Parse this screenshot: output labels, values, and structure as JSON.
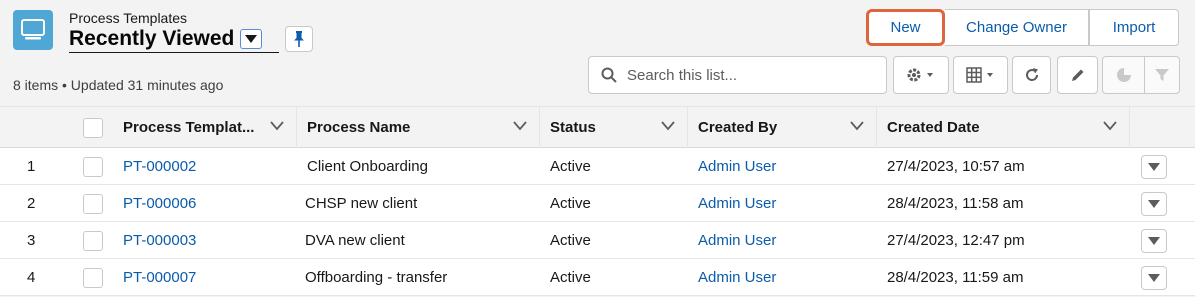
{
  "header": {
    "object_icon": "desktop-icon",
    "object_name": "Process Templates",
    "list_view": "Recently Viewed",
    "list_info": "8 items • Updated 31 minutes ago"
  },
  "actions": {
    "new": "New",
    "change_owner": "Change Owner",
    "import": "Import"
  },
  "search": {
    "placeholder": "Search this list..."
  },
  "toolbar": [
    "settings-icon",
    "table-display-icon",
    "refresh-icon",
    "edit-icon",
    "chart-icon",
    "filter-icon"
  ],
  "table": {
    "columns": [
      "Process Templat...",
      "Process Name",
      "Status",
      "Created By",
      "Created Date"
    ],
    "rows": [
      {
        "num": "1",
        "id": "PT-000002",
        "name": "Client Onboarding",
        "status": "Active",
        "created_by": "Admin User",
        "created_date": "27/4/2023, 10:57 am"
      },
      {
        "num": "2",
        "id": "PT-000006",
        "name": "CHSP new client",
        "status": "Active",
        "created_by": "Admin User",
        "created_date": "28/4/2023, 11:58 am"
      },
      {
        "num": "3",
        "id": "PT-000003",
        "name": "DVA new client",
        "status": "Active",
        "created_by": "Admin User",
        "created_date": "27/4/2023, 12:47 pm"
      },
      {
        "num": "4",
        "id": "PT-000007",
        "name": "Offboarding - transfer",
        "status": "Active",
        "created_by": "Admin User",
        "created_date": "28/4/2023, 11:59 am"
      }
    ]
  },
  "colors": {
    "accent": "#0b5cab",
    "highlight": "#e0643e",
    "object_icon_bg": "#4fa7d6"
  }
}
